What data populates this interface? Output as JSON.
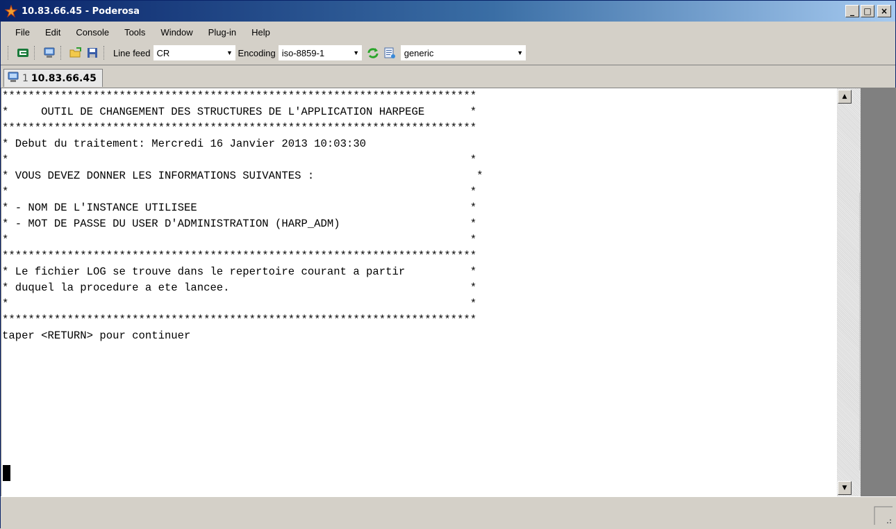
{
  "window": {
    "title": "10.83.66.45 - Poderosa",
    "minimize": "_",
    "maximize": "□",
    "close": "×"
  },
  "menu": {
    "items": [
      "File",
      "Edit",
      "Console",
      "Tools",
      "Window",
      "Plug-in",
      "Help"
    ]
  },
  "toolbar": {
    "line_feed_label": "Line feed",
    "line_feed_value": "CR",
    "encoding_label": "Encoding",
    "encoding_value": "iso-8859-1",
    "terminal_type_value": "generic"
  },
  "tab": {
    "number": "1",
    "host": "10.83.66.45"
  },
  "terminal": {
    "lines": [
      "*************************************************************************",
      "*     OUTIL DE CHANGEMENT DES STRUCTURES DE L'APPLICATION HARPEGE       *",
      "*************************************************************************",
      "* Debut du traitement: Mercredi 16 Janvier 2013 10:03:30",
      "*                                                                       *",
      "* VOUS DEVEZ DONNER LES INFORMATIONS SUIVANTES :                         *",
      "*                                                                       *",
      "* - NOM DE L'INSTANCE UTILISEE                                          *",
      "* - MOT DE PASSE DU USER D'ADMINISTRATION (HARP_ADM)                    *",
      "*                                                                       *",
      "*************************************************************************",
      "* Le fichier LOG se trouve dans le repertoire courant a partir          *",
      "* duquel la procedure a ete lancee.                                     *",
      "*                                                                       *",
      "*************************************************************************",
      "taper <RETURN> pour continuer"
    ]
  },
  "icons": {
    "app": "poderosa-icon",
    "new_connection": "new-connection-icon",
    "open_shell": "shell-icon",
    "open_folder": "open-folder-icon",
    "save": "save-icon",
    "reload": "reload-icon",
    "terminal_settings": "terminal-settings-icon"
  }
}
